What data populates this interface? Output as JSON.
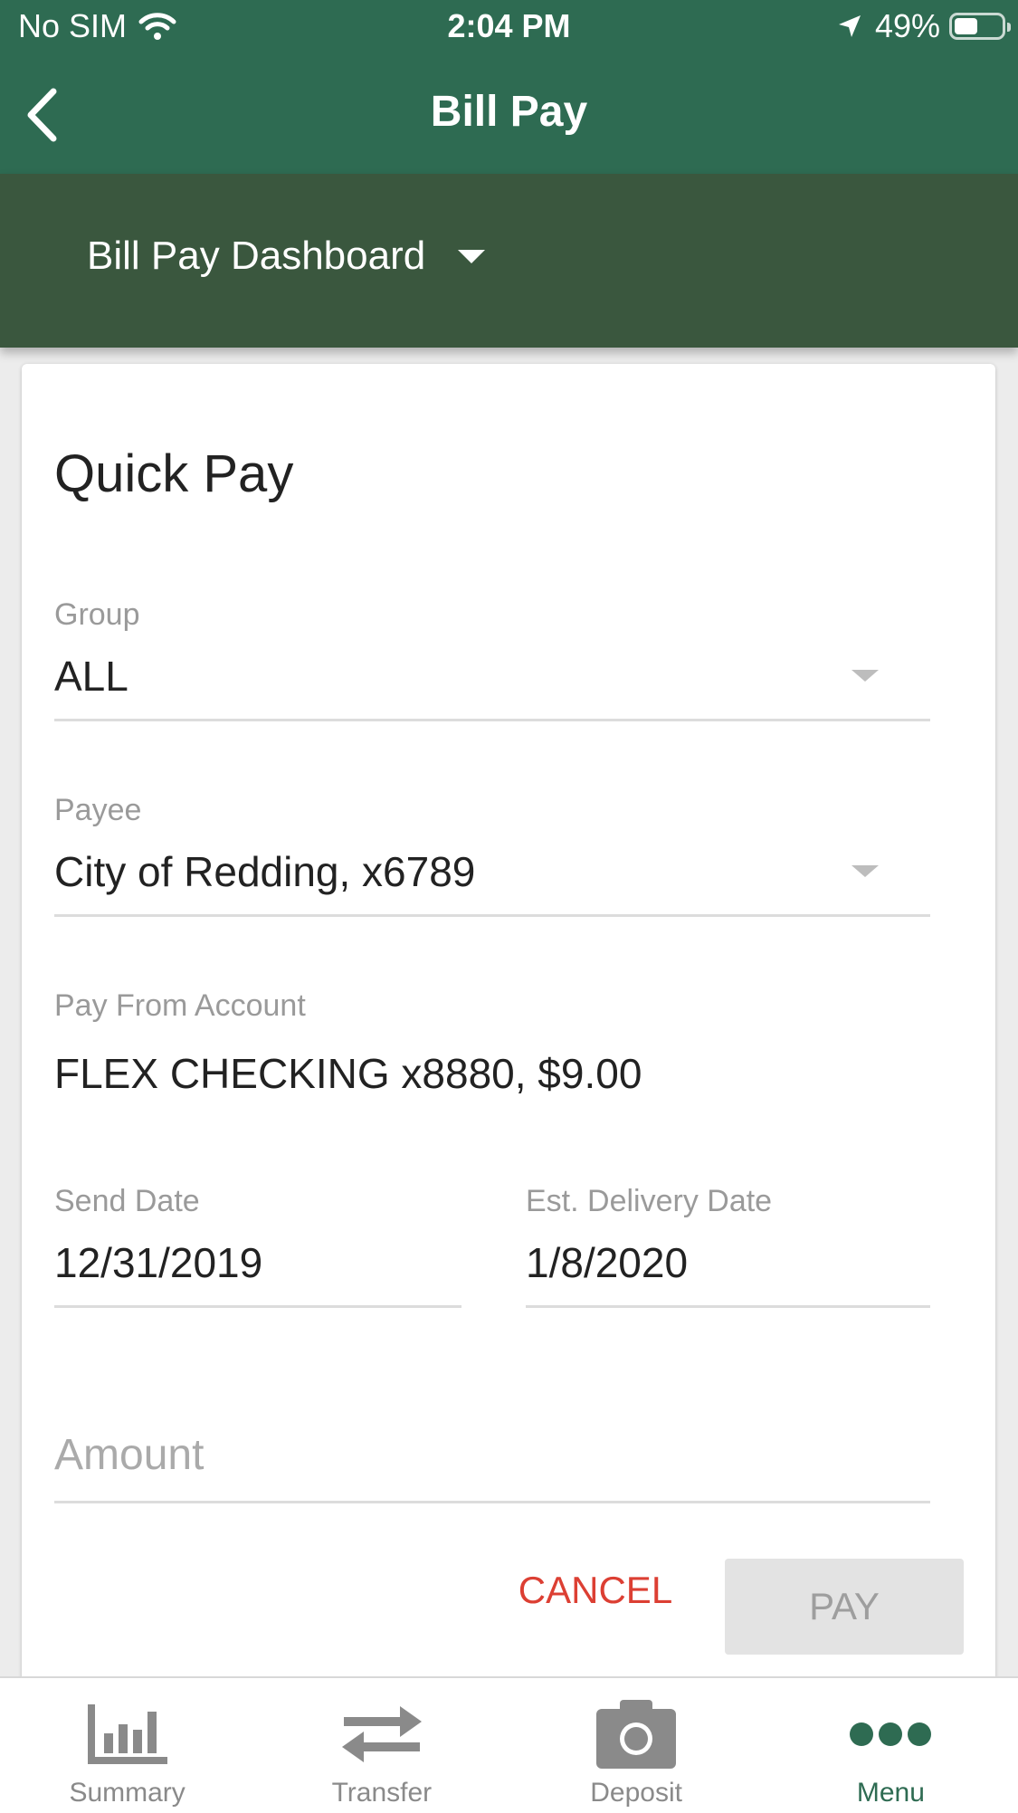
{
  "status_bar": {
    "carrier": "No SIM",
    "time": "2:04 PM",
    "battery": "49%",
    "battery_level": 0.49
  },
  "header": {
    "title": "Bill Pay",
    "back_icon": "chevron-left-icon"
  },
  "dashboard_select": {
    "label": "Bill Pay Dashboard"
  },
  "quick_pay": {
    "title": "Quick Pay",
    "group": {
      "label": "Group",
      "value": "ALL"
    },
    "payee": {
      "label": "Payee",
      "value": "City of Redding, x6789"
    },
    "pay_from": {
      "label": "Pay From Account",
      "value": "FLEX CHECKING x8880, $9.00"
    },
    "send_date": {
      "label": "Send Date",
      "value": "12/31/2019"
    },
    "delivery_date": {
      "label": "Est. Delivery Date",
      "value": "1/8/2020"
    },
    "amount": {
      "placeholder": "Amount",
      "value": ""
    },
    "cancel_label": "CANCEL",
    "pay_label": "PAY"
  },
  "colors": {
    "header": "#2e6b52",
    "dashboard_band": "#3a573e",
    "cancel": "#dc3f33",
    "active_tab": "#2e6b52"
  },
  "tabs": [
    {
      "label": "Summary",
      "icon": "bar-chart-icon",
      "active": false
    },
    {
      "label": "Transfer",
      "icon": "transfer-arrows-icon",
      "active": false
    },
    {
      "label": "Deposit",
      "icon": "camera-icon",
      "active": false
    },
    {
      "label": "Menu",
      "icon": "more-dots-icon",
      "active": true
    }
  ]
}
